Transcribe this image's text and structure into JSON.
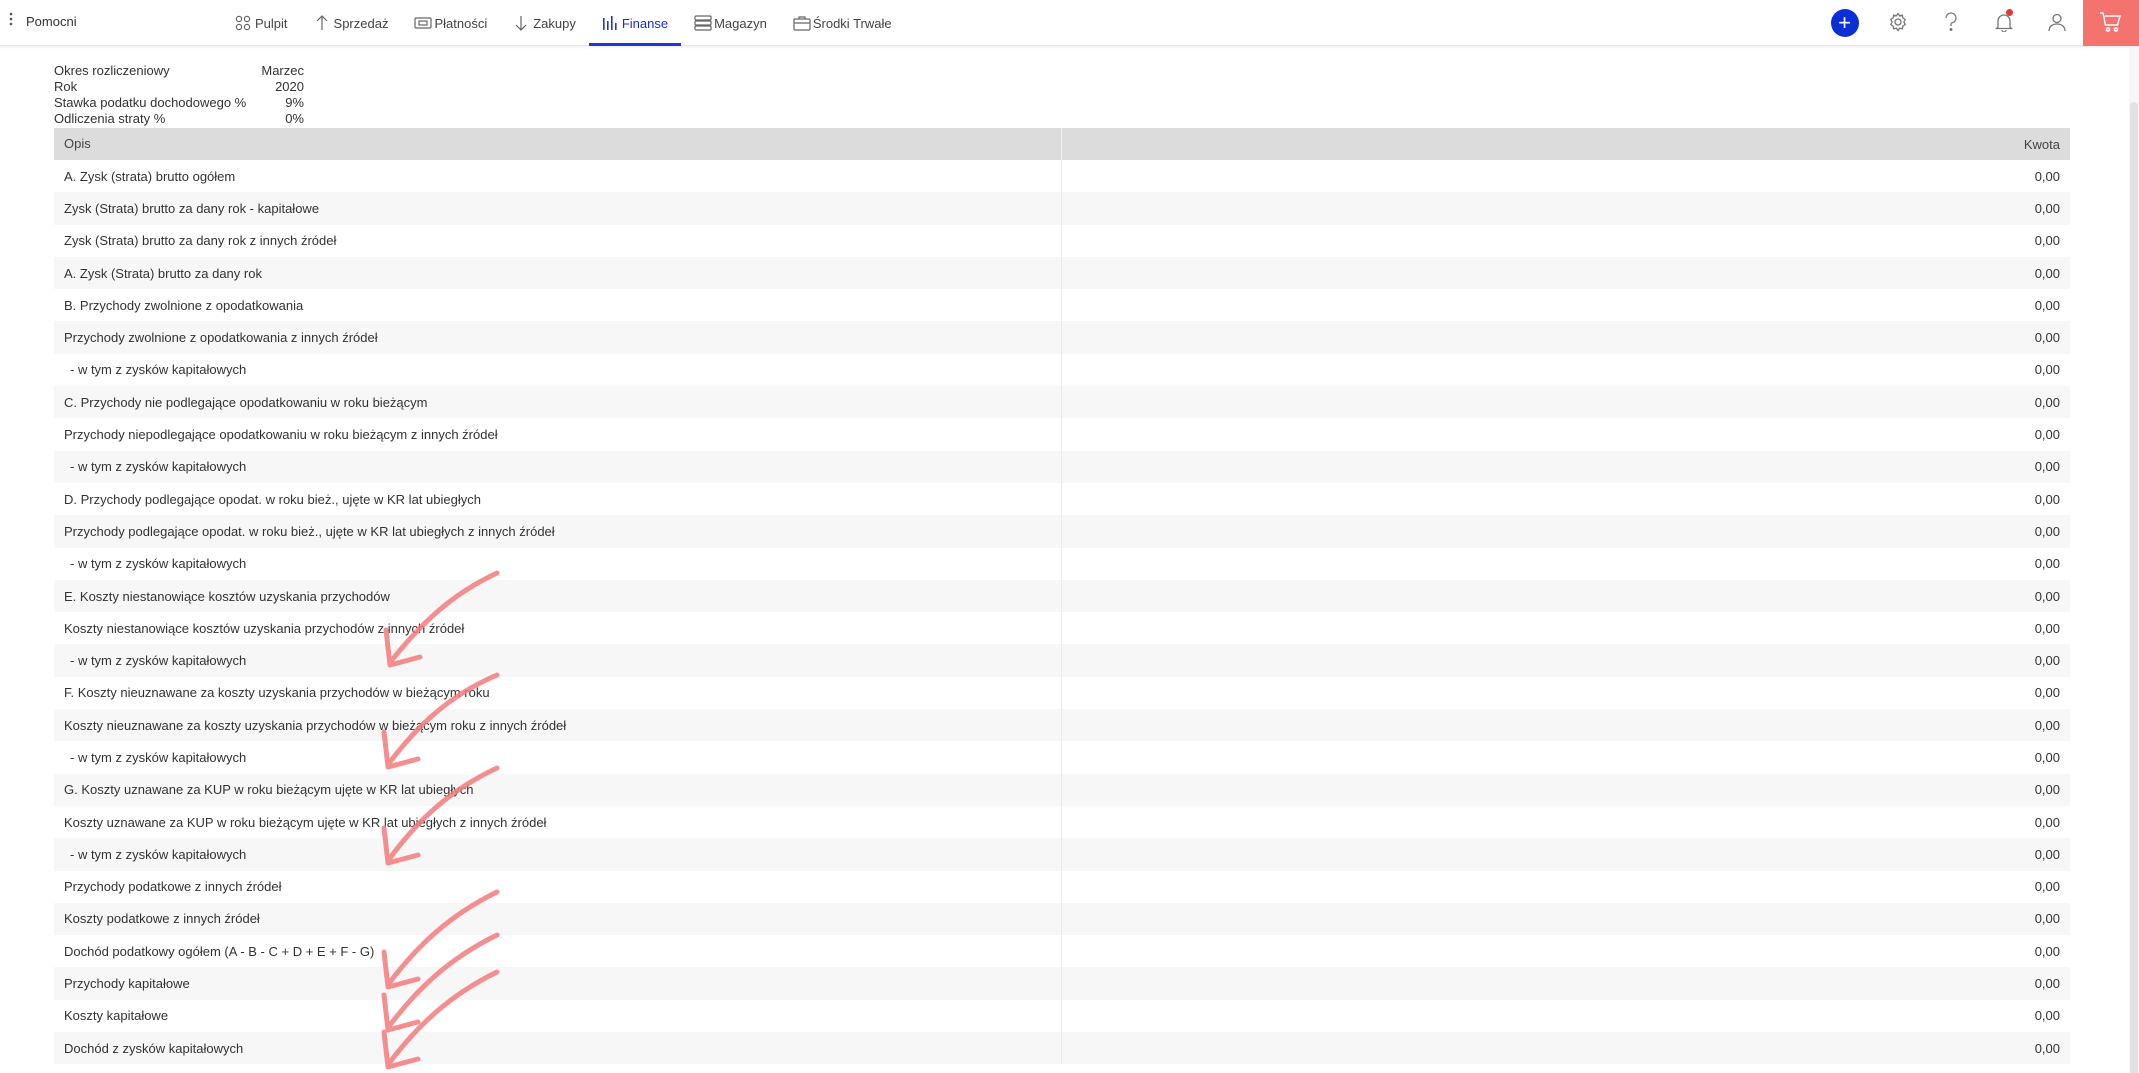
{
  "header": {
    "menu_icon": "vertical-dots-icon",
    "app_name": "Pomocni",
    "nav": [
      {
        "label": "Pulpit",
        "icon": "grid-icon"
      },
      {
        "label": "Sprzedaż",
        "icon": "arrow-up-icon"
      },
      {
        "label": "Płatności",
        "icon": "payment-icon"
      },
      {
        "label": "Zakupy",
        "icon": "arrow-down-icon"
      },
      {
        "label": "Finanse",
        "icon": "bar-chart-icon",
        "active": true
      },
      {
        "label": "Magazyn",
        "icon": "stack-icon"
      },
      {
        "label": "Środki Trwałe",
        "icon": "briefcase-icon"
      }
    ],
    "accent_color": "#2136d4",
    "cart_color": "#f5736f"
  },
  "info": [
    {
      "label": "Okres rozliczeniowy",
      "value": "Marzec"
    },
    {
      "label": "Rok",
      "value": "2020"
    },
    {
      "label": "Stawka podatku dochodowego %",
      "value": "9%"
    },
    {
      "label": "Odliczenia straty %",
      "value": "0%"
    }
  ],
  "table": {
    "headers": {
      "opis": "Opis",
      "kwota": "Kwota"
    },
    "rows": [
      {
        "opis": "A. Zysk (strata) brutto ogółem",
        "kwota": "0,00"
      },
      {
        "opis": "Zysk (Strata) brutto za dany rok - kapitałowe",
        "kwota": "0,00"
      },
      {
        "opis": "Zysk (Strata) brutto za dany rok z innych źródeł",
        "kwota": "0,00"
      },
      {
        "opis": "A. Zysk (Strata) brutto za dany rok",
        "kwota": "0,00"
      },
      {
        "opis": "B. Przychody zwolnione z opodatkowania",
        "kwota": "0,00"
      },
      {
        "opis": "Przychody zwolnione z opodatkowania z innych źródeł",
        "kwota": "0,00"
      },
      {
        "opis": " - w tym z zysków kapitałowych",
        "kwota": "0,00",
        "indent": true
      },
      {
        "opis": "C. Przychody nie podlegające opodatkowaniu w roku bieżącym",
        "kwota": "0,00"
      },
      {
        "opis": "Przychody niepodlegające opodatkowaniu w roku bieżącym z innych źródeł",
        "kwota": "0,00"
      },
      {
        "opis": "- w tym z zysków kapitałowych",
        "kwota": "0,00",
        "indent": true
      },
      {
        "opis": "D. Przychody podlegające opodat. w roku bież., ujęte w KR lat ubiegłych",
        "kwota": "0,00"
      },
      {
        "opis": "Przychody podlegające opodat. w roku bież., ujęte w KR lat ubiegłych z innych źródeł",
        "kwota": "0,00"
      },
      {
        "opis": " - w tym z zysków kapitałowych",
        "kwota": "0,00",
        "indent": true
      },
      {
        "opis": "E. Koszty niestanowiące kosztów uzyskania przychodów",
        "kwota": "0,00"
      },
      {
        "opis": "Koszty niestanowiące kosztów uzyskania przychodów z innych źródeł",
        "kwota": "0,00"
      },
      {
        "opis": " - w tym z zysków kapitałowych",
        "kwota": "0,00",
        "indent": true
      },
      {
        "opis": "F. Koszty nieuznawane za koszty uzyskania przychodów w bieżącym roku",
        "kwota": "0,00"
      },
      {
        "opis": "Koszty nieuznawane za koszty uzyskania przychodów w bieżącym roku z innych źródeł",
        "kwota": "0,00"
      },
      {
        "opis": " - w tym z zysków kapitałowych",
        "kwota": "0,00",
        "indent": true
      },
      {
        "opis": "G. Koszty uznawane za KUP w roku bieżącym ujęte w KR lat ubiegłych",
        "kwota": "0,00"
      },
      {
        "opis": "Koszty uznawane za KUP w roku bieżącym ujęte w KR lat ubiegłych z innych źródeł",
        "kwota": "0,00"
      },
      {
        "opis": " - w tym z zysków kapitałowych",
        "kwota": "0,00",
        "indent": true
      },
      {
        "opis": "Przychody podatkowe z innych źródeł",
        "kwota": "0,00"
      },
      {
        "opis": "Koszty podatkowe z innych źródeł",
        "kwota": "0,00"
      },
      {
        "opis": "Dochód podatkowy ogółem (A - B - C + D + E + F - G)",
        "kwota": "0,00"
      },
      {
        "opis": "Przychody kapitałowe",
        "kwota": "0,00"
      },
      {
        "opis": "Koszty kapitałowe",
        "kwota": "0,00"
      },
      {
        "opis": "Dochód z zysków kapitałowych",
        "kwota": "0,00"
      }
    ]
  },
  "annotation_color": "#f47c7c"
}
